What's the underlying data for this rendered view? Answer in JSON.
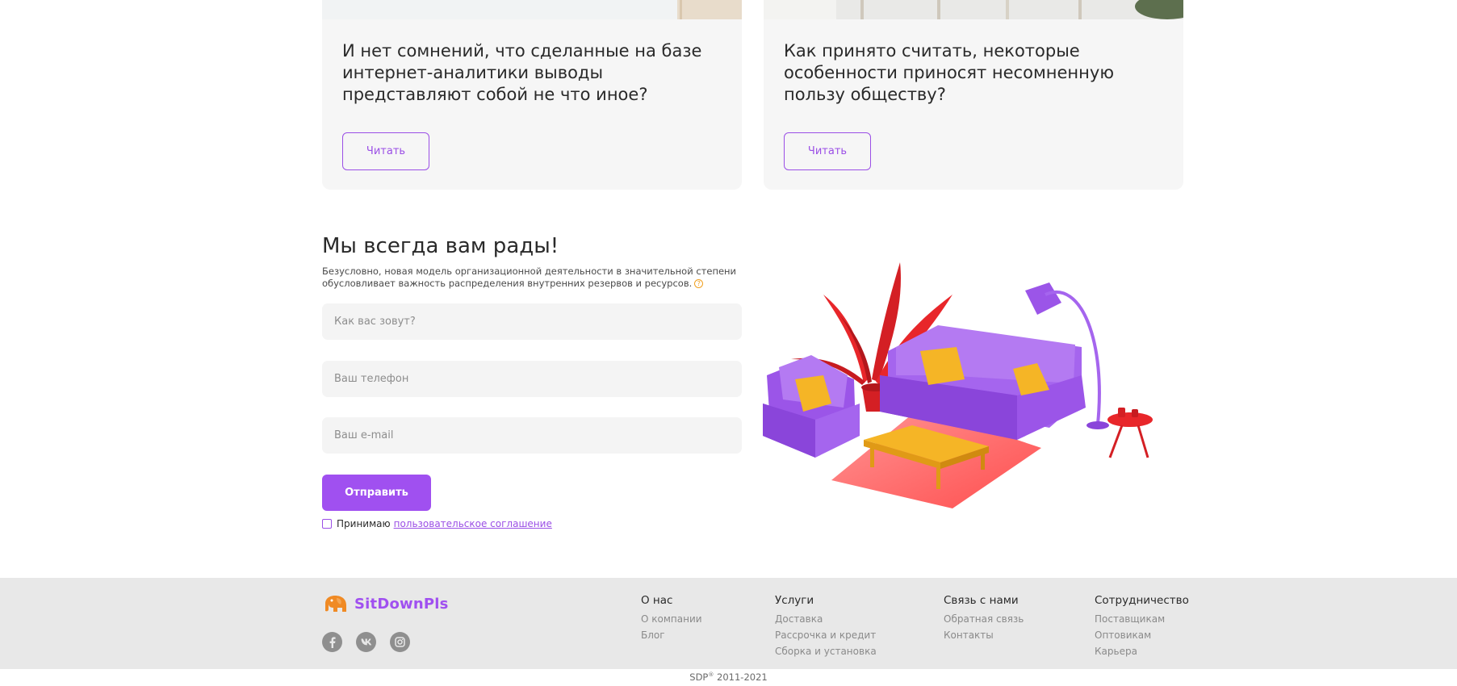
{
  "articles": [
    {
      "title": "И нет сомнений, что сделанные на базе интернет-аналитики выводы представляют собой не что иное?",
      "button": "Читать"
    },
    {
      "title": "Как принято считать, некоторые особенности приносят несомненную пользу обществу?",
      "button": "Читать"
    }
  ],
  "form": {
    "title": "Мы всегда вам рады!",
    "description": "Безусловно, новая модель организационной деятельности в значительной степени обусловливает важность распределения внутренних резервов и ресурсов.",
    "help_icon": "?",
    "name_placeholder": "Как вас зовут?",
    "phone_placeholder": "Ваш телефон",
    "email_placeholder": "Ваш e-mail",
    "submit_label": "Отправить",
    "agree_label": "Принимаю",
    "agree_link": "пользовательское соглашение"
  },
  "footer": {
    "logo_text": "SitDownPls",
    "columns": [
      {
        "title": "О нас",
        "links": [
          "О компании",
          "Блог"
        ]
      },
      {
        "title": "Услуги",
        "links": [
          "Доставка",
          "Рассрочка и кредит",
          "Сборка и установка"
        ]
      },
      {
        "title": "Связь с нами",
        "links": [
          "Обратная связь",
          "Контакты"
        ]
      },
      {
        "title": "Сотрудничество",
        "links": [
          "Поставщикам",
          "Оптовикам",
          "Карьера"
        ]
      }
    ],
    "socials": [
      "facebook-icon",
      "vk-icon",
      "instagram-icon"
    ],
    "copyright_prefix": "SDP",
    "copyright_mark": "®",
    "copyright_years": " 2011-2021"
  },
  "colors": {
    "accent": "#a050f0",
    "card_bg": "#f6f6f6",
    "footer_bg": "#e8e8e8",
    "logo_orange": "#f08a24"
  }
}
